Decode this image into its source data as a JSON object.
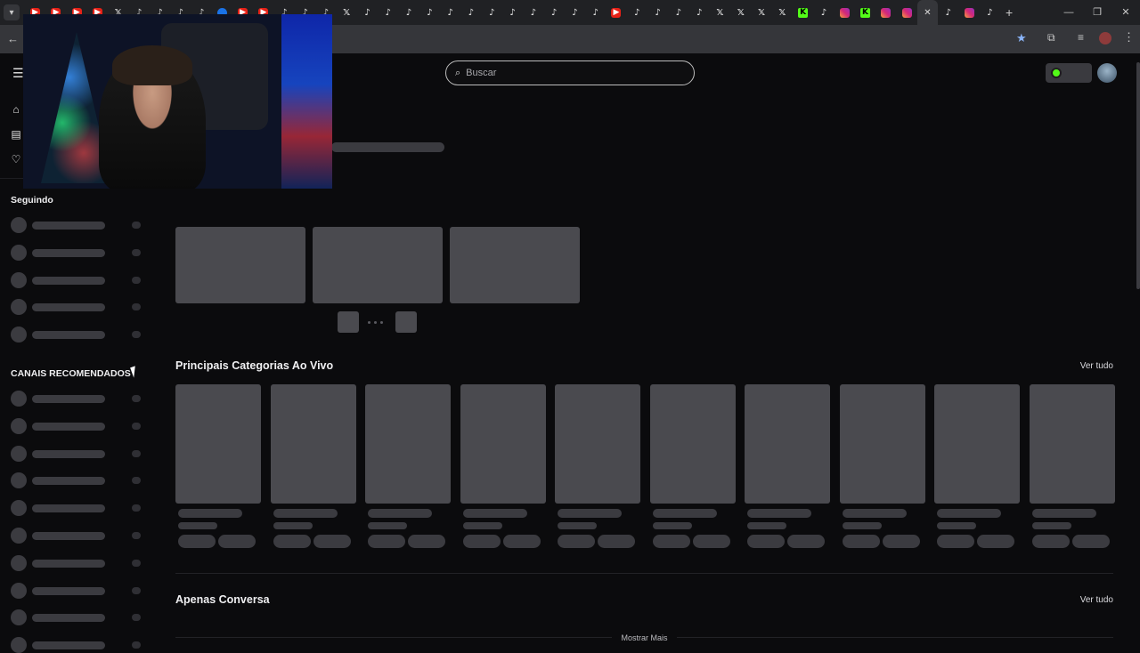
{
  "browser": {
    "tab_icons": [
      "youtube",
      "youtube",
      "youtube",
      "youtube",
      "x",
      "tiktok",
      "tiktok",
      "tiktok",
      "tiktok",
      "chrome",
      "youtube",
      "youtube",
      "tiktok",
      "tiktok",
      "tiktok",
      "x",
      "tiktok",
      "tiktok",
      "tiktok",
      "tiktok",
      "tiktok",
      "tiktok",
      "tiktok",
      "tiktok",
      "tiktok",
      "tiktok",
      "tiktok",
      "tiktok",
      "youtube",
      "tiktok",
      "tiktok",
      "tiktok",
      "tiktok",
      "x",
      "x",
      "x",
      "x",
      "kick",
      "tiktok",
      "instagram",
      "kick",
      "instagram",
      "instagram",
      "close",
      "tiktok",
      "instagram",
      "tiktok"
    ],
    "active_tab_index": 43,
    "new_tab_label": "+",
    "accent": "#8ab4f8"
  },
  "header": {
    "search_placeholder": "Buscar",
    "brand_green": "#53fc18"
  },
  "sidebar": {
    "following_title": "Seguindo",
    "recommended_title": "CANAIS RECOMENDADOS"
  },
  "main": {
    "top_categories_title": "Principais Categorias Ao Vivo",
    "top_categories_see_all": "Ver tudo",
    "just_chatting_title": "Apenas Conversa",
    "just_chatting_see_all": "Ver tudo",
    "show_more": "Mostrar Mais"
  }
}
